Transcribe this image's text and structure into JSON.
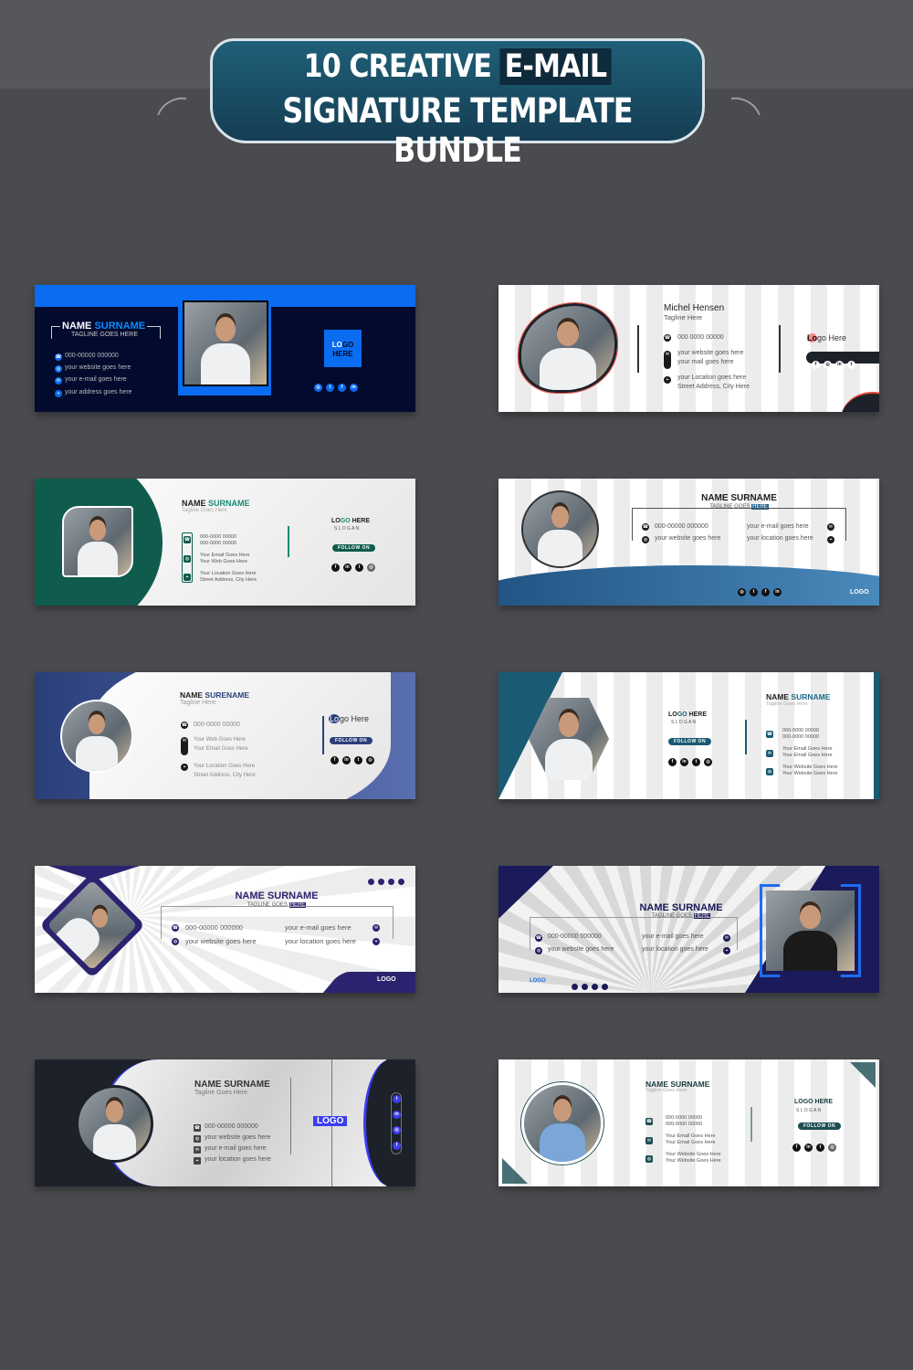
{
  "header": {
    "title_line1_a": "10 CREATIVE",
    "title_line1_b": "E-MAIL",
    "title_line2": "SIGNATURE TEMPLATE BUNDLE"
  },
  "colors": {
    "background": "#4a4b4f",
    "banner": "#1f5f78"
  },
  "cards": [
    {
      "name_a": "NAME",
      "name_b": "SURNAME",
      "tagline": "TAGLINE GOES HERE",
      "contacts": [
        "000-00000 000000",
        "your website goes here",
        "your e-mail goes here",
        "your address goes here"
      ],
      "logo_a": "LO",
      "logo_b": "GO",
      "logo_c": "HERE",
      "accent": "#0a6cf0"
    },
    {
      "name": "Michel Hensen",
      "tagline": "Tagline Here",
      "contacts": [
        "000 0000 00000",
        "your website goes here",
        "your mail goes here",
        "your Location goes here",
        "Street Address, City Here"
      ],
      "logo_a": "Lo",
      "logo_b": "go Here",
      "accent": "#e8483c"
    },
    {
      "name_a": "NAME",
      "name_b": "SURNAME",
      "tagline": "Tagline Goes Here",
      "contacts": [
        "000-0000 00000",
        "000-0000 00000",
        "Your Email Goes Here",
        "Your Web Goes Here",
        "Your Location Goes Here",
        "Street Address, City Here"
      ],
      "logo_a": "LO",
      "logo_b": "GO",
      "logo_c": "HERE",
      "slogan": "S L O G A N",
      "follow": "FOLLOW ON",
      "accent": "#0f5c4e"
    },
    {
      "name": "NAME SURNAME",
      "tagline": "TAGLINE GOES",
      "tagline_hl": "HERE",
      "contacts": [
        "000-00000 000000",
        "your website goes here",
        "your e-mail goes here",
        "your location goes here"
      ],
      "logo": "LOGO",
      "accent": "#1f5f8f"
    },
    {
      "name_a": "NAME",
      "name_b": "SURENAME",
      "tagline": "Tagline Here",
      "contacts": [
        "000-0000 00000",
        "Your Web Goes Here",
        "Your Email Goes Here",
        "Your Location Goes Here",
        "Street Address, City Here"
      ],
      "logo_a": "Lo",
      "logo_b": "go Here",
      "follow": "FOLLOW ON",
      "accent": "#2a3f7a"
    },
    {
      "name_a": "NAME",
      "name_b": "SURNAME",
      "tagline": "Tagline Goes Here",
      "contacts": [
        "000-0000 00000",
        "000-0000 00000",
        "Your Email Goes Here",
        "Your Email Goes Here",
        "Your Website Goes Here",
        "Your Website Goes Here"
      ],
      "logo_a": "LO",
      "logo_b": "GO",
      "logo_c": "HERE",
      "slogan": "S L O G A N",
      "follow": "FOLLOW ON",
      "accent": "#1a5a73"
    },
    {
      "name": "NAME SURNAME",
      "tagline": "TAGLINE GOES",
      "tagline_hl": "HERE",
      "contacts": [
        "000-00000 000000",
        "your website goes here",
        "your e-mail goes here",
        "your location goes here"
      ],
      "logo": "LOGO",
      "accent": "#2b2370"
    },
    {
      "name": "NAME SURNAME",
      "tagline": "TAGLINE GOES",
      "tagline_hl": "HERE",
      "contacts": [
        "000-00000 000000",
        "your website goes here",
        "your e-mail goes here",
        "your location goes here"
      ],
      "logo": "LOGO",
      "accent": "#1b1a5a"
    },
    {
      "name": "NAME SURNAME",
      "tagline": "Tagline Goes Here",
      "contacts": [
        "000-00000 000000",
        "your website goes here",
        "your e-mail goes here",
        "your location goes here"
      ],
      "logo": "LOGO",
      "accent": "#3b3df0"
    },
    {
      "name": "NAME SURNAME",
      "tagline": "Tagline Goes Here",
      "contacts": [
        "000-0000 00000",
        "000-0000 00000",
        "Your Email Goes Here",
        "Your Email Goes Here",
        "Your Website Goes Here",
        "Your Website Goes Here"
      ],
      "logo": "LOGO HERE",
      "slogan": "S L O G A N",
      "follow": "FOLLOW ON",
      "accent": "#1c4d52"
    }
  ]
}
